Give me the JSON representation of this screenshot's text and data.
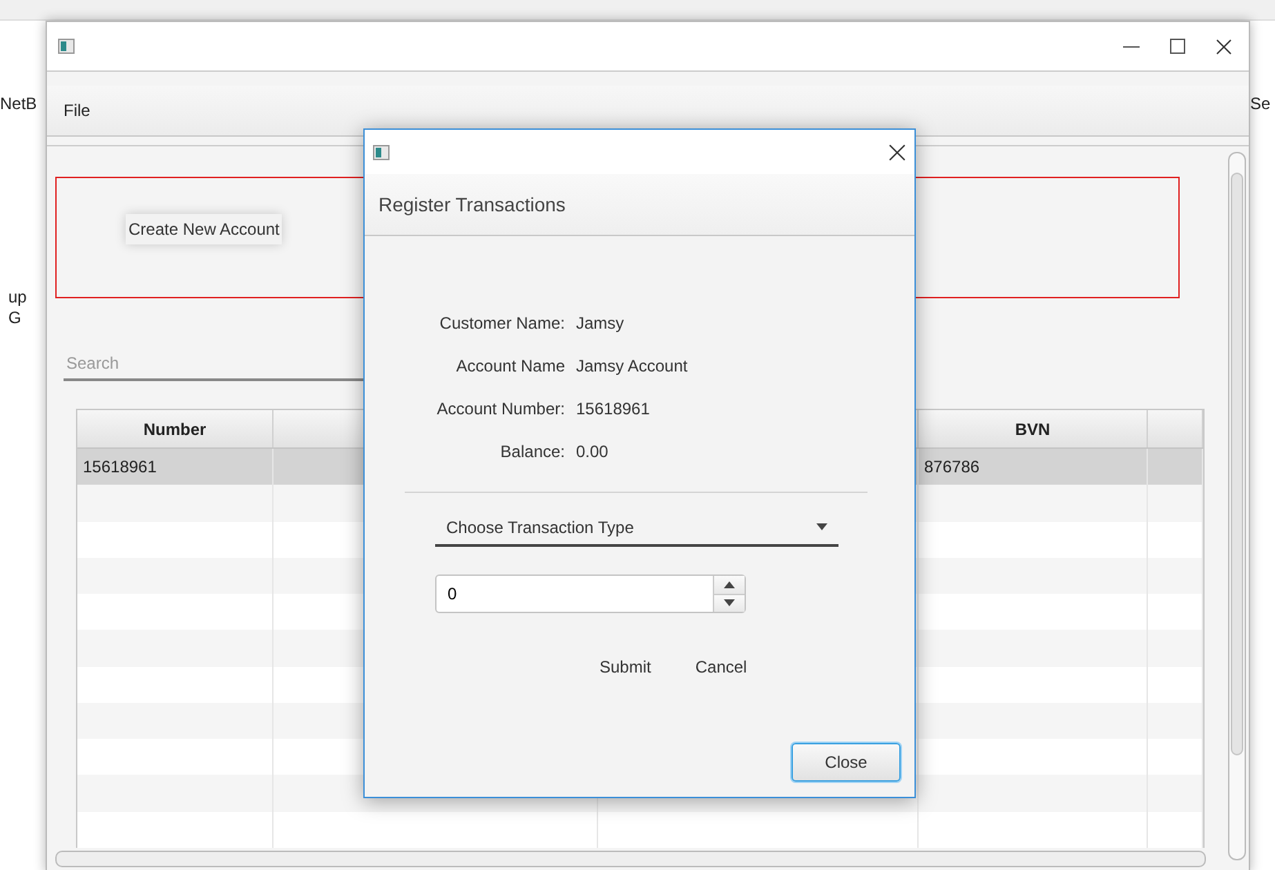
{
  "background_fragments": {
    "left_top": "NetB",
    "left_lines": [
      "up",
      "G"
    ],
    "right_top": "Se"
  },
  "window": {
    "menu": [
      "File"
    ],
    "create_button": "Create New Account",
    "search": {
      "placeholder": "Search"
    },
    "table": {
      "columns": [
        {
          "label": "Number"
        },
        {},
        {},
        {
          "label": "BVN"
        },
        {}
      ],
      "rows": [
        {
          "cells": [
            "15618961",
            null,
            null,
            "876786",
            null
          ],
          "selected": true
        }
      ]
    }
  },
  "dialog": {
    "header": "Register Transactions",
    "details": [
      {
        "label": "Customer Name:",
        "value": "Jamsy"
      },
      {
        "label": "Account Name",
        "value": "Jamsy Account"
      },
      {
        "label": "Account Number:",
        "value": "15618961"
      },
      {
        "label": "Balance:",
        "value": "0.00"
      }
    ],
    "transaction_type": {
      "placeholder": "Choose Transaction Type"
    },
    "amount": {
      "value": "0"
    },
    "actions": [
      "Submit",
      "Cancel"
    ],
    "close_button": "Close"
  }
}
